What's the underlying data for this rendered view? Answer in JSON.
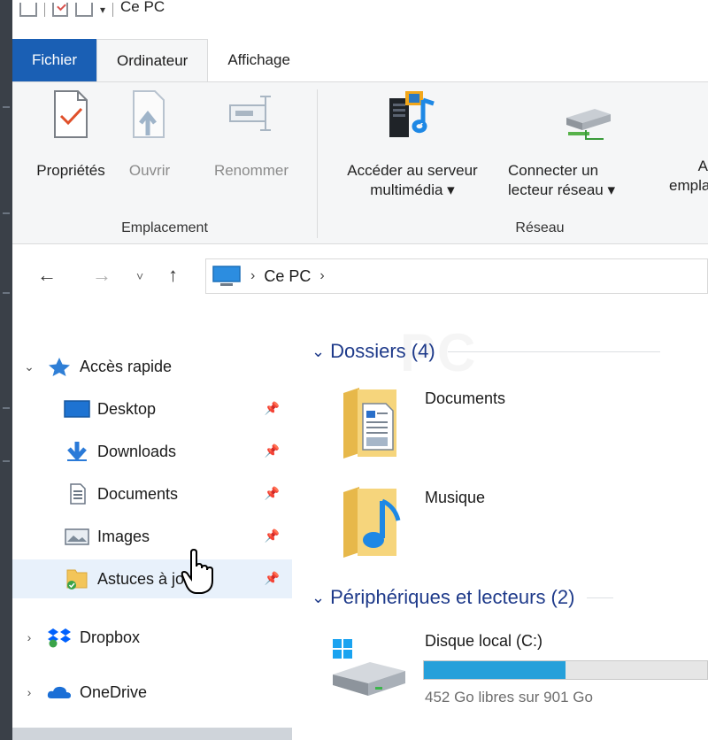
{
  "titlebar": {
    "title": "Ce PC"
  },
  "tabs": [
    {
      "label": "Fichier"
    },
    {
      "label": "Ordinateur"
    },
    {
      "label": "Affichage"
    }
  ],
  "ribbon": {
    "groups": [
      {
        "name": "Emplacement",
        "buttons": [
          {
            "label": "Propriétés",
            "icon": "properties-icon",
            "enabled": true
          },
          {
            "label": "Ouvrir",
            "icon": "open-icon",
            "enabled": false
          },
          {
            "label": "Renommer",
            "icon": "rename-icon",
            "enabled": false
          }
        ]
      },
      {
        "name": "Réseau",
        "buttons": [
          {
            "label_line1": "Accéder au serveur",
            "label_line2": "multimédia ▾",
            "icon": "media-server-icon",
            "enabled": true
          },
          {
            "label_line1": "Connecter un",
            "label_line2": "lecteur réseau ▾",
            "icon": "network-drive-icon",
            "enabled": true
          },
          {
            "label_line1": "A",
            "label_line2": "empla",
            "icon": "add-location-icon",
            "enabled": true
          }
        ]
      }
    ]
  },
  "address": {
    "crumbs": [
      "Ce PC"
    ],
    "separator": "›"
  },
  "nav": {
    "quick_access": "Accès rapide",
    "items": [
      {
        "label": "Desktop",
        "icon": "desktop-icon"
      },
      {
        "label": "Downloads",
        "icon": "downloads-icon"
      },
      {
        "label": "Documents",
        "icon": "documents-icon"
      },
      {
        "label": "Images",
        "icon": "images-icon"
      },
      {
        "label": "Astuces à jour",
        "icon": "folder-sync-icon"
      }
    ],
    "dropbox": "Dropbox",
    "onedrive": "OneDrive"
  },
  "content": {
    "folders_header": "Dossiers (4)",
    "folders": [
      {
        "label": "Documents",
        "icon": "documents-folder-icon"
      },
      {
        "label": "Musique",
        "icon": "music-folder-icon"
      }
    ],
    "devices_header": "Périphériques et lecteurs (2)",
    "drive": {
      "label": "Disque local (C:)",
      "free_text": "452 Go libres sur 901 Go",
      "used_fraction": 0.5
    }
  },
  "colors": {
    "accent": "#1a5fb4",
    "header_blue": "#1e3a8a",
    "drive_bar": "#26a0da",
    "selected_bg": "#e8f1fb"
  }
}
